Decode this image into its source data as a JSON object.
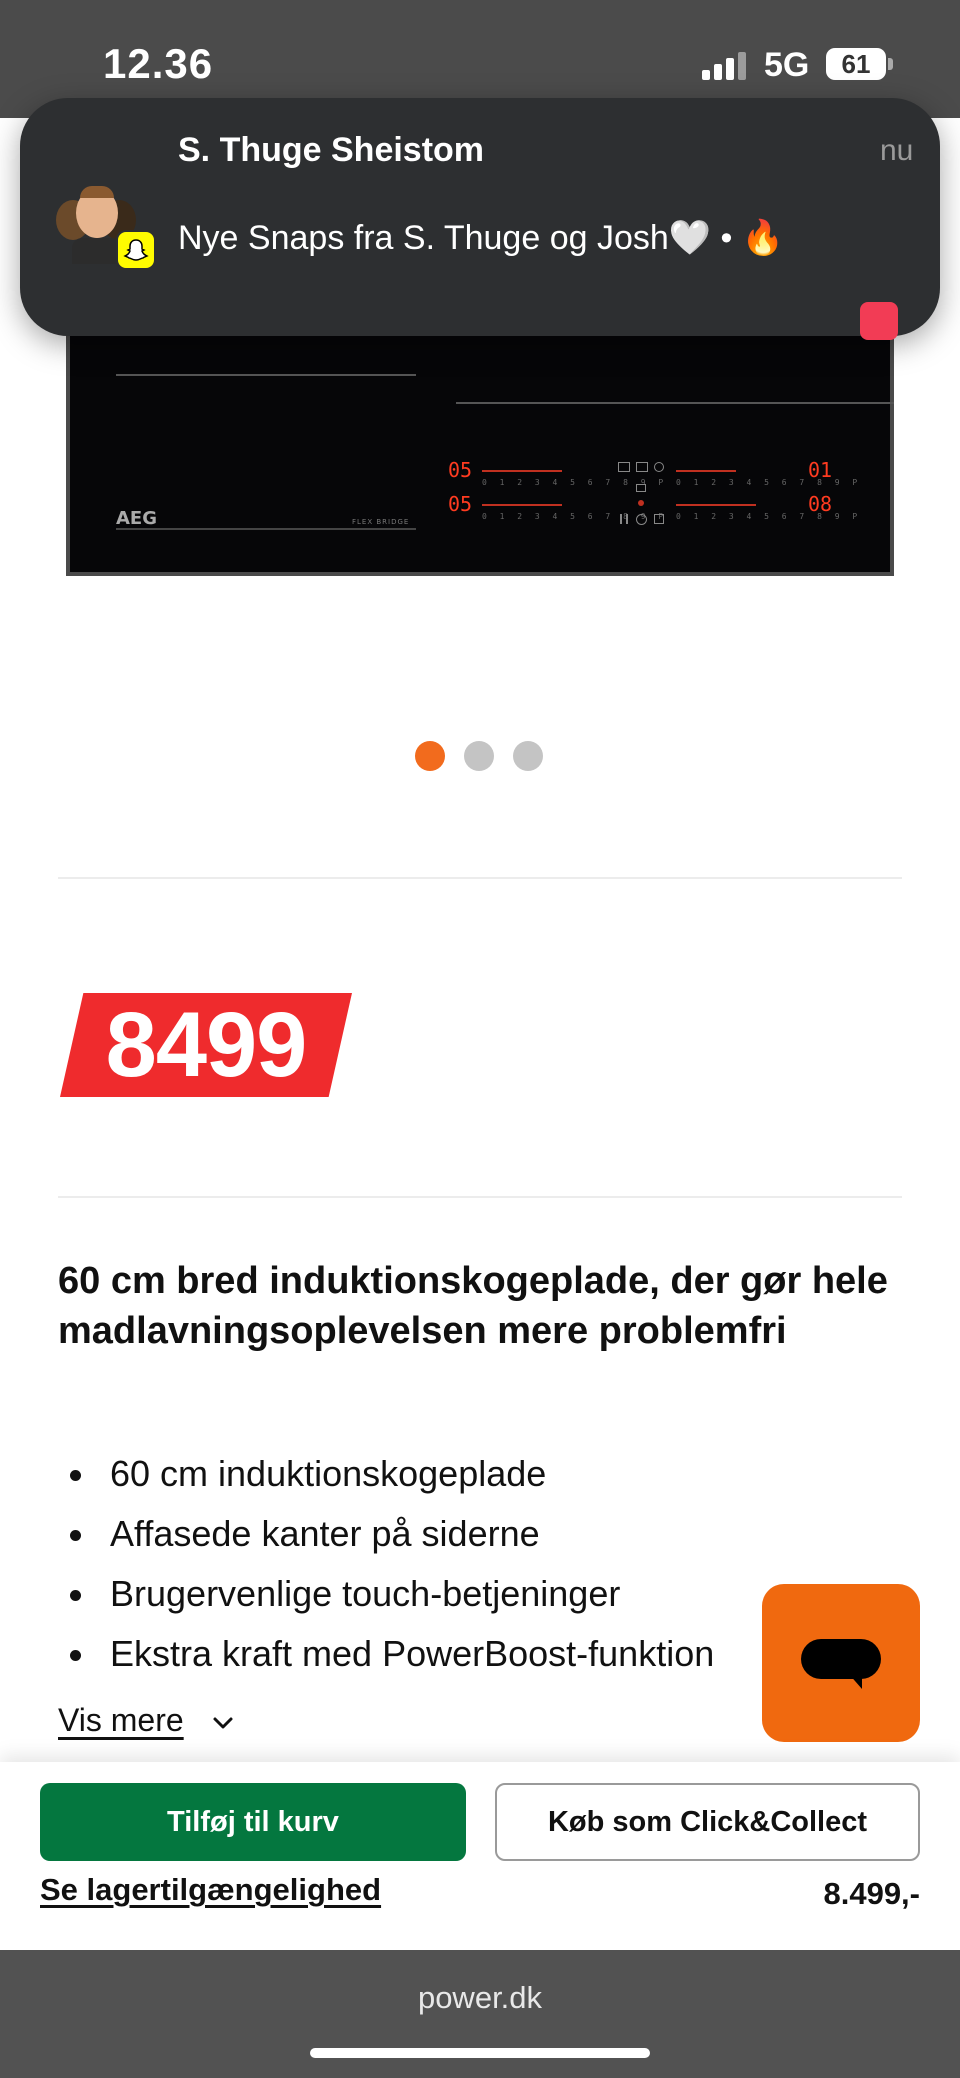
{
  "status_bar": {
    "time": "12.36",
    "network": "5G",
    "battery": "61"
  },
  "notification": {
    "app_icon": "snapchat-icon",
    "sender": "S. Thuge Sheistom",
    "message": "Nye Snaps fra S. Thuge og Josh🤍 • 🔥",
    "time": "nu"
  },
  "product_image": {
    "brand_logo": "AEG",
    "model_label": "FLEX BRIDGE",
    "left_display_top": "05",
    "left_display_bottom": "05",
    "right_display_top": "01",
    "right_display_bottom": "08",
    "scale_digits": "0 1 2 3 4 5 6 7 8 9 P"
  },
  "carousel": {
    "dots": 3,
    "active_index": 0
  },
  "price": {
    "amount": "8499"
  },
  "product": {
    "title": "60 cm bred induktionskogeplade, der gør hele madlavningsoplevelsen mere problemfri",
    "features": [
      "60 cm induktionskogeplade",
      "Affasede kanter på siderne",
      "Brugervenlige touch-betjeninger",
      "Ekstra kraft med PowerBoost-funktion"
    ],
    "show_more_label": "Vis mere"
  },
  "actions": {
    "add_to_cart_label": "Tilføj til kurv",
    "click_collect_label": "Køb som Click&Collect",
    "stock_link_label": "Se lagertilgængelighed",
    "price_label": "8.499,-"
  },
  "colors": {
    "accent_orange": "#f26b1d",
    "price_red": "#ef2b2d",
    "cart_green": "#04773f",
    "chat_orange": "#f0690f"
  },
  "browser": {
    "url": "power.dk"
  }
}
